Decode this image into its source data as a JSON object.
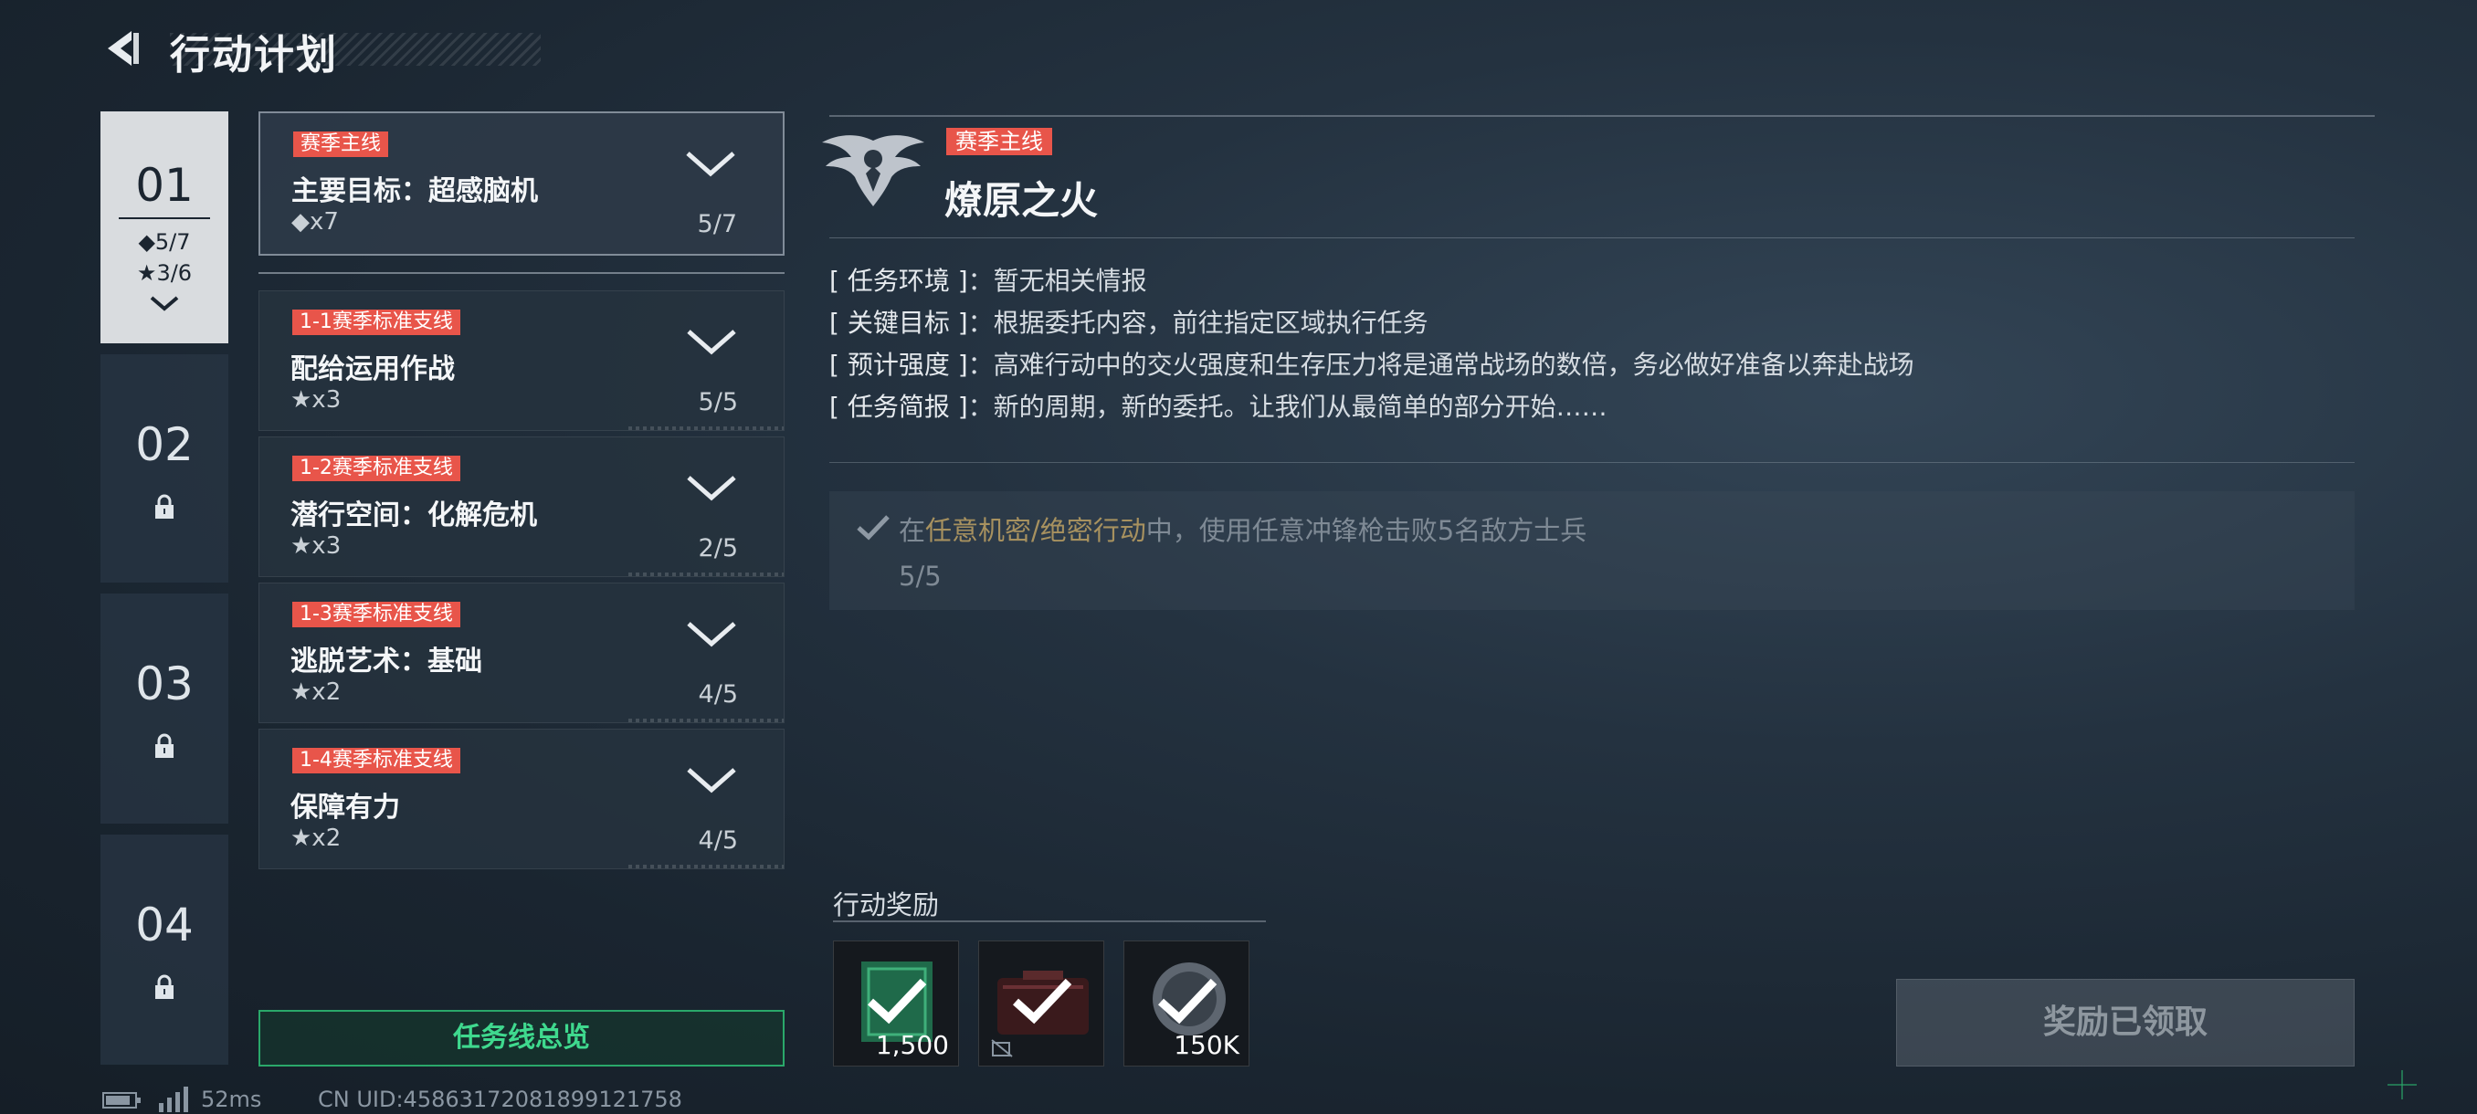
{
  "header": {
    "title": "行动计划"
  },
  "chapters": [
    {
      "num": "01",
      "diamond": "◆5/7",
      "star": "★3/6",
      "active": true
    },
    {
      "num": "02",
      "locked": true
    },
    {
      "num": "03",
      "locked": true
    },
    {
      "num": "04",
      "locked": true
    }
  ],
  "missions": [
    {
      "tag": "赛季主线",
      "name": "主要目标：超感脑机",
      "reward": "◆x7",
      "progress": "5/7"
    },
    {
      "tag": "1-1赛季标准支线",
      "name": "配给运用作战",
      "reward": "★x3",
      "progress": "5/5"
    },
    {
      "tag": "1-2赛季标准支线",
      "name": "潜行空间：化解危机",
      "reward": "★x3",
      "progress": "2/5"
    },
    {
      "tag": "1-3赛季标准支线",
      "name": "逃脱艺术：基础",
      "reward": "★x2",
      "progress": "4/5"
    },
    {
      "tag": "1-4赛季标准支线",
      "name": "保障有力",
      "reward": "★x2",
      "progress": "4/5"
    }
  ],
  "overview_button": "任务线总览",
  "status": {
    "ping": "52ms",
    "uid": "CN UID:45863172081899121758"
  },
  "detail": {
    "tag": "赛季主线",
    "title": "燎原之火",
    "info": [
      {
        "label": "[ 任务环境 ]",
        "value": "：暂无相关情报"
      },
      {
        "label": "[ 关键目标 ]",
        "value": "：根据委托内容，前往指定区域执行任务"
      },
      {
        "label": "[ 预计强度 ]",
        "value": "：高难行动中的交火强度和生存压力将是通常战场的数倍，务必做好准备以奔赴战场"
      },
      {
        "label": "[ 任务简报 ]",
        "value": "：新的周期，新的委托。让我们从最简单的部分开始……"
      }
    ],
    "objective": {
      "prefix": "在",
      "highlight": "任意机密/绝密行动",
      "suffix": "中，使用任意冲锋枪击败5名敌方士兵",
      "progress": "5/5"
    },
    "rewards_label": "行动奖励",
    "rewards": [
      {
        "icon": "badge-icon",
        "amount": "1,500"
      },
      {
        "icon": "case-icon",
        "amount": ""
      },
      {
        "icon": "coin-icon",
        "amount": "150K"
      }
    ],
    "claimed_button": "奖励已领取"
  },
  "colors": {
    "tag_red": "#e8554a",
    "accent_green": "#3fd98e",
    "highlight_gold": "#a7915f"
  }
}
